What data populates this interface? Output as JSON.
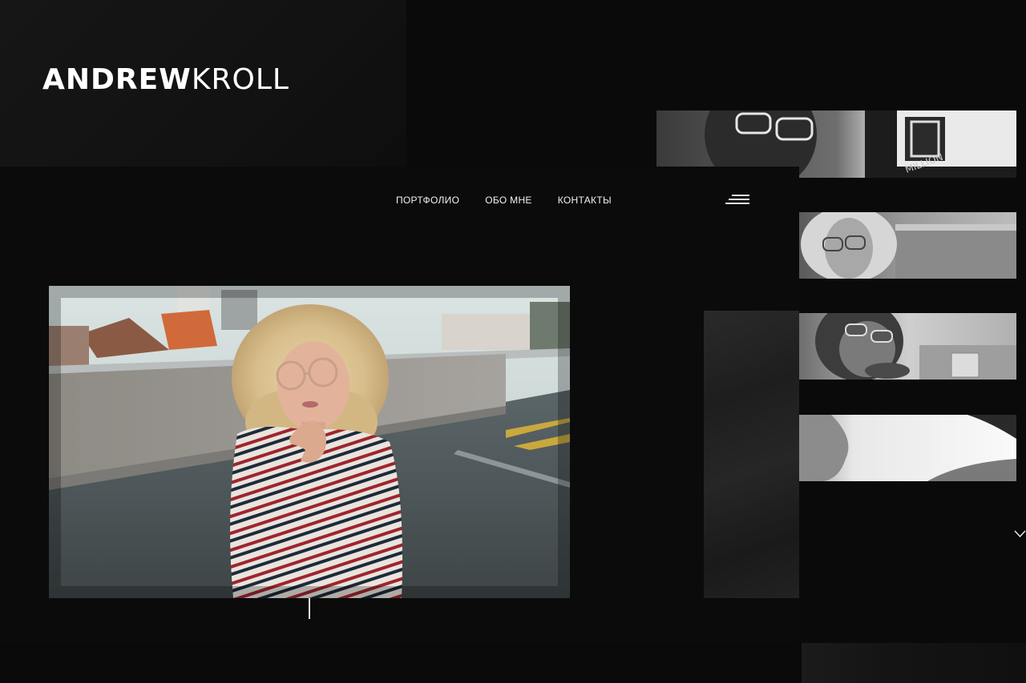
{
  "brand": {
    "name_bold": "ANDREW",
    "name_light": "KROLL"
  },
  "nav": {
    "items": [
      {
        "label": "ПОРТФОЛИО"
      },
      {
        "label": "ОБО МНЕ"
      },
      {
        "label": "КОНТАКТЫ"
      }
    ]
  },
  "icons": {
    "menu": "hamburger-menu-icon",
    "scroll_down": "chevron-down-icon"
  },
  "thumbnails": [
    {
      "subject": "man with glasses and neon sign"
    },
    {
      "subject": "curly-haired woman with glasses"
    },
    {
      "subject": "bearded man with sunglasses"
    },
    {
      "subject": "profile portrait in bright light"
    }
  ],
  "hero": {
    "subject": "curly-haired woman in striped shirt on rooftop parking"
  },
  "colors": {
    "background": "#0a0a0a",
    "text": "#ffffff"
  }
}
